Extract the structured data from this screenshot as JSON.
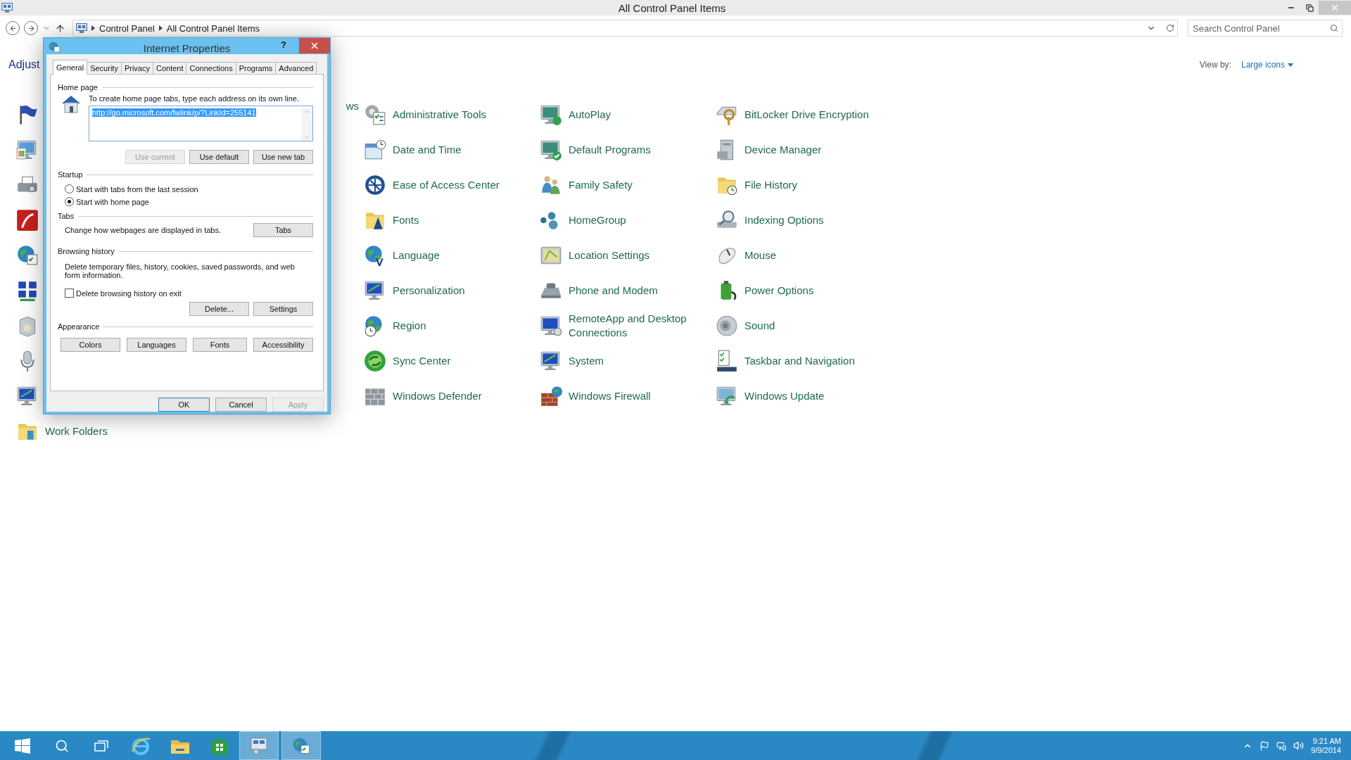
{
  "window": {
    "title": "All Control Panel Items"
  },
  "address": {
    "breadcrumbs": [
      "Control Panel",
      "All Control Panel Items"
    ],
    "search_placeholder": "Search Control Panel"
  },
  "header": {
    "title": "Adjust",
    "view_by_label": "View by:",
    "view_by_value": "Large icons"
  },
  "items": [
    {
      "kind": "tail",
      "label": "ws"
    },
    {
      "kind": "item",
      "label": "Administrative Tools"
    },
    {
      "kind": "item",
      "label": "AutoPlay"
    },
    {
      "kind": "item",
      "label": "BitLocker Drive Encryption"
    },
    {
      "kind": "icon"
    },
    {
      "kind": "item",
      "label": "Date and Time"
    },
    {
      "kind": "item",
      "label": "Default Programs"
    },
    {
      "kind": "item",
      "label": "Device Manager"
    },
    {
      "kind": "icon"
    },
    {
      "kind": "item",
      "label": "Ease of Access Center"
    },
    {
      "kind": "item",
      "label": "Family Safety"
    },
    {
      "kind": "item",
      "label": "File History"
    },
    {
      "kind": "icon"
    },
    {
      "kind": "item",
      "label": "Fonts"
    },
    {
      "kind": "item",
      "label": "HomeGroup"
    },
    {
      "kind": "item",
      "label": "Indexing Options"
    },
    {
      "kind": "icon"
    },
    {
      "kind": "item",
      "label": "Language"
    },
    {
      "kind": "item",
      "label": "Location Settings"
    },
    {
      "kind": "item",
      "label": "Mouse"
    },
    {
      "kind": "icon"
    },
    {
      "kind": "item",
      "label": "Personalization"
    },
    {
      "kind": "item",
      "label": "Phone and Modem"
    },
    {
      "kind": "item",
      "label": "Power Options"
    },
    {
      "kind": "icon"
    },
    {
      "kind": "item",
      "label": "Region"
    },
    {
      "kind": "item",
      "label": "RemoteApp and Desktop Connections"
    },
    {
      "kind": "item",
      "label": "Sound"
    },
    {
      "kind": "icon"
    },
    {
      "kind": "item",
      "label": "Sync Center"
    },
    {
      "kind": "item",
      "label": "System"
    },
    {
      "kind": "item",
      "label": "Taskbar and Navigation"
    },
    {
      "kind": "icon"
    },
    {
      "kind": "item",
      "label": "Windows Defender"
    },
    {
      "kind": "item",
      "label": "Windows Firewall"
    },
    {
      "kind": "item",
      "label": "Windows Update"
    },
    {
      "kind": "item",
      "label": "Work Folders"
    }
  ],
  "dialog": {
    "title": "Internet Properties",
    "help": "?",
    "tabs": [
      {
        "label": "General",
        "selected": true
      },
      {
        "label": "Security",
        "selected": false
      },
      {
        "label": "Privacy",
        "selected": false
      },
      {
        "label": "Content",
        "selected": false
      },
      {
        "label": "Connections",
        "selected": false
      },
      {
        "label": "Programs",
        "selected": false
      },
      {
        "label": "Advanced",
        "selected": false
      }
    ],
    "home_page": {
      "title": "Home page",
      "description": "To create home page tabs, type each address on its own line.",
      "url": "http://go.microsoft.com/fwlink/p/?LinkId=255141",
      "url_selected": true,
      "buttons": [
        {
          "label": "Use current",
          "disabled": true
        },
        {
          "label": "Use default",
          "disabled": false
        },
        {
          "label": "Use new tab",
          "disabled": false
        }
      ]
    },
    "startup": {
      "title": "Startup",
      "options": [
        {
          "label": "Start with tabs from the last session",
          "selected": false
        },
        {
          "label": "Start with home page",
          "selected": true
        }
      ]
    },
    "tabs_section": {
      "title": "Tabs",
      "description": "Change how webpages are displayed in tabs.",
      "button": "Tabs"
    },
    "history": {
      "title": "Browsing history",
      "description": "Delete temporary files, history, cookies, saved passwords, and web form information.",
      "checkbox": {
        "label": "Delete browsing history on exit",
        "checked": false
      },
      "buttons": [
        "Delete...",
        "Settings"
      ]
    },
    "appearance": {
      "title": "Appearance",
      "buttons": [
        "Colors",
        "Languages",
        "Fonts",
        "Accessibility"
      ]
    },
    "footer": [
      {
        "label": "OK",
        "default": true,
        "disabled": false
      },
      {
        "label": "Cancel",
        "default": false,
        "disabled": false
      },
      {
        "label": "Apply",
        "default": false,
        "disabled": true
      }
    ]
  },
  "taskbar": {
    "apps": [
      {
        "kind": "start",
        "active": false
      },
      {
        "kind": "search",
        "active": false
      },
      {
        "kind": "taskview",
        "active": false
      },
      {
        "kind": "browser",
        "active": false
      },
      {
        "kind": "explorer",
        "active": false
      },
      {
        "kind": "store",
        "active": false
      },
      {
        "kind": "control",
        "active": true
      },
      {
        "kind": "internet",
        "active": true
      }
    ],
    "time": "9:21 AM",
    "date": "9/9/2014"
  }
}
